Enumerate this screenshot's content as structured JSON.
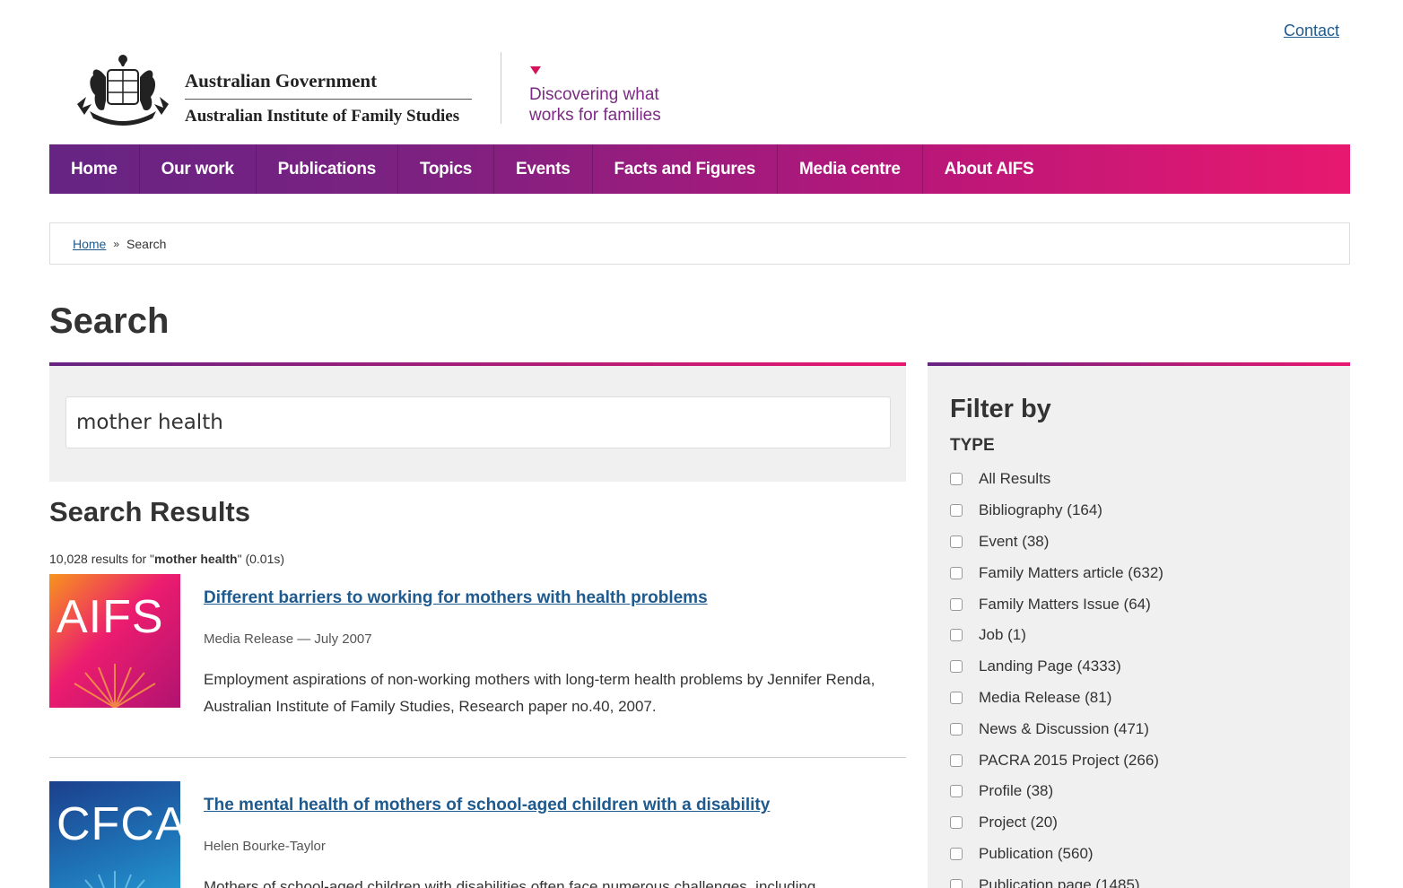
{
  "top_links": {
    "contact": "Contact"
  },
  "header": {
    "gov_name": "Australian Government",
    "institute_name": "Australian Institute of Family Studies",
    "tagline_line1": "Discovering what",
    "tagline_line2": "works for families"
  },
  "nav": {
    "items": [
      "Home",
      "Our work",
      "Publications",
      "Topics",
      "Events",
      "Facts and Figures",
      "Media centre",
      "About AIFS"
    ]
  },
  "breadcrumb": {
    "home": "Home",
    "separator": "»",
    "current": "Search"
  },
  "page": {
    "title": "Search"
  },
  "search": {
    "query": "mother health"
  },
  "results": {
    "heading": "Search Results",
    "count_prefix": "10,028 results for \"",
    "count_query": "mother health",
    "count_suffix": "\" (0.01s)",
    "items": [
      {
        "thumb_label": "AIFS",
        "title": "Different barriers to working for mothers with health problems",
        "meta": "Media Release — July 2007",
        "description": "Employment aspirations of non-working mothers with long-term health problems by Jennifer Renda, Australian Institute of Family Studies, Research paper no.40, 2007."
      },
      {
        "thumb_label": "CFCA",
        "title": "The mental health of mothers of school-aged children with a disability",
        "meta": "Helen Bourke-Taylor",
        "description": "Mothers of school-aged children with disabilities often face numerous challenges, including"
      }
    ]
  },
  "filter": {
    "title": "Filter by",
    "subtitle": "TYPE",
    "options": [
      "All Results",
      "Bibliography (164)",
      "Event (38)",
      "Family Matters article (632)",
      "Family Matters Issue (64)",
      "Job (1)",
      "Landing Page (4333)",
      "Media Release (81)",
      "News & Discussion (471)",
      "PACRA 2015 Project (266)",
      "Profile (38)",
      "Project (20)",
      "Publication (560)",
      "Publication page (1485)"
    ]
  },
  "colors": {
    "nav_gradient_start": "#662483",
    "nav_gradient_end": "#e8186f",
    "link": "#1e5a8e",
    "tagline": "#7b2b83"
  }
}
